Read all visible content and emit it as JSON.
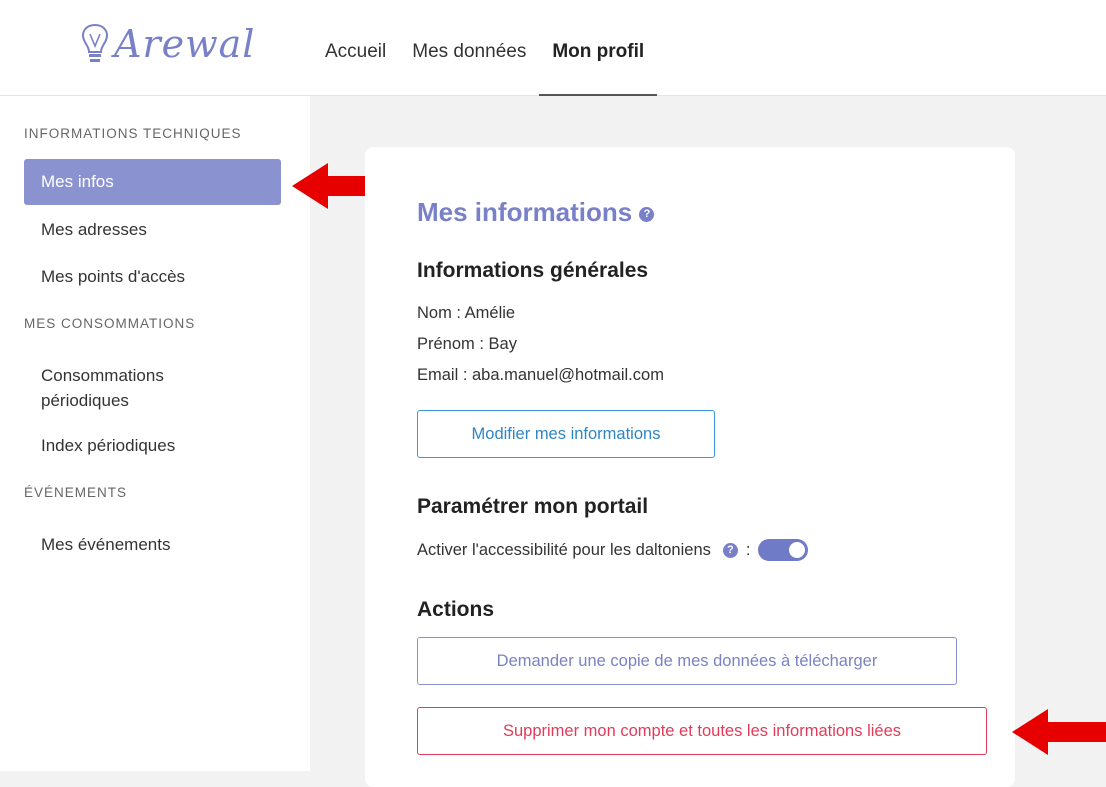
{
  "app": {
    "logo_text": "Arewal"
  },
  "nav": {
    "items": [
      {
        "label": "Accueil"
      },
      {
        "label": "Mes données"
      },
      {
        "label": "Mon profil"
      }
    ]
  },
  "sidebar": {
    "sections": [
      {
        "title": "INFORMATIONS TECHNIQUES",
        "items": [
          {
            "label": "Mes infos"
          },
          {
            "label": "Mes adresses"
          },
          {
            "label": "Mes points d'accès"
          }
        ]
      },
      {
        "title": "MES CONSOMMATIONS",
        "items": [
          {
            "label_line1": "Consommations",
            "label_line2": "périodiques"
          },
          {
            "label": "Index périodiques"
          }
        ]
      },
      {
        "title": "ÉVÉNEMENTS",
        "items": [
          {
            "label": "Mes événements"
          }
        ]
      }
    ]
  },
  "main": {
    "title": "Mes informations",
    "help_icon_glyph": "?",
    "general": {
      "heading": "Informations générales",
      "name": "Nom : Amélie",
      "firstname": "Prénom : Bay",
      "email": "Email : aba.manuel@hotmail.com",
      "edit_button": "Modifier mes informations"
    },
    "portal": {
      "heading": "Paramétrer mon portail",
      "accessibility_label": "Activer l'accessibilité pour les daltoniens",
      "separator": ":",
      "accessibility_enabled": true
    },
    "actions": {
      "heading": "Actions",
      "download_button": "Demander une copie de mes données à télécharger",
      "delete_button": "Supprimer mon compte et toutes les informations liées"
    }
  },
  "colors": {
    "accent": "#7880c8",
    "active_sidebar": "#8a93cf",
    "danger": "#e23b5a",
    "link_blue": "#2f86c4",
    "annotation_arrow": "#e60000"
  }
}
